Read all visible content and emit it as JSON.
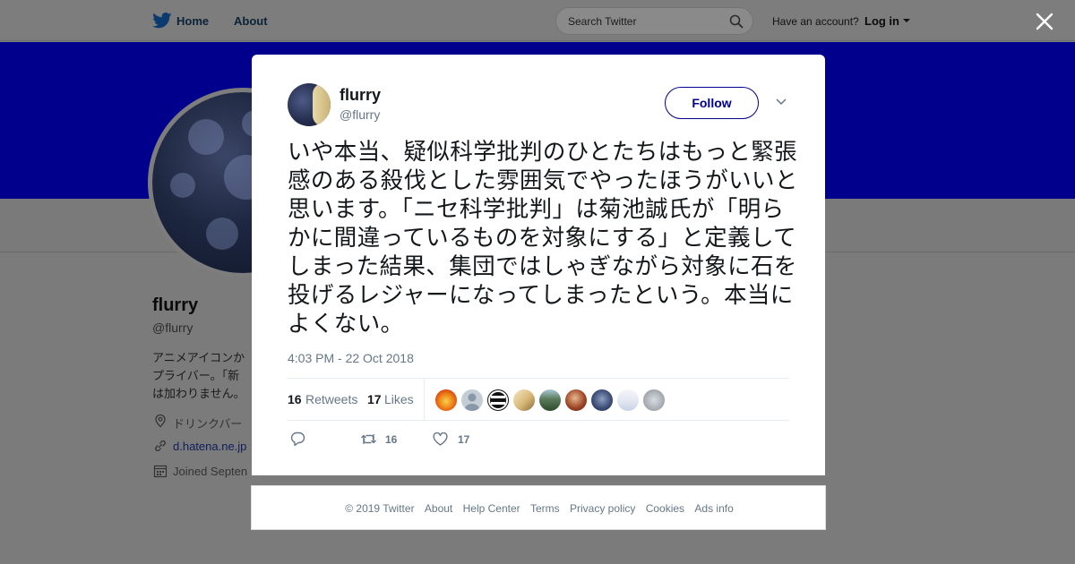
{
  "nav": {
    "home_label": "Home",
    "about_label": "About",
    "search_placeholder": "Search Twitter",
    "have_account": "Have an account?",
    "login_label": "Log in"
  },
  "colors": {
    "brand": "#00008c",
    "banner": "#00008c",
    "overlay": "#7b7b7b",
    "muted_text": "#657786"
  },
  "profile": {
    "name": "flurry",
    "handle": "@flurry",
    "bio_line1": "アニメアイコンか",
    "bio_line2": "プライバー。「新",
    "bio_line3": "は加わりません。",
    "location": "ドリンクバー",
    "link": "d.hatena.ne.jp",
    "joined": "Joined Septen"
  },
  "tweet": {
    "name": "flurry",
    "handle": "@flurry",
    "follow_label": "Follow",
    "text": "いや本当、疑似科学批判のひとたちはもっと緊張感のある殺伐とした雰囲気でやったほうがいいと思います。「ニセ科学批判」は菊池誠氏が「明らかに間違っているものを対象にする」と定義してしまった結果、集団ではしゃぎながら対象に石を投げるレジャーになってしまったという。本当によくない。",
    "timestamp": "4:03 PM - 22 Oct 2018",
    "retweets_count": "16",
    "retweets_label": "Retweets",
    "likes_count": "17",
    "likes_label": "Likes",
    "action_retweets": "16",
    "action_likes": "17",
    "liker_avatars": [
      "orange-flame",
      "default-gray",
      "funk-logo",
      "anime-blonde",
      "landscape-green",
      "anime-red",
      "blue-figure",
      "white-text-banner",
      "gray-cat"
    ]
  },
  "icons": {
    "bird": "twitter-bird-icon",
    "search": "search-icon",
    "close": "close-icon",
    "chevron": "chevron-down-icon",
    "reply": "reply-icon",
    "retweet": "retweet-icon",
    "like": "heart-icon",
    "location": "location-pin-icon",
    "link": "link-icon",
    "calendar": "calendar-icon"
  },
  "footer": {
    "links": [
      "© 2019 Twitter",
      "About",
      "Help Center",
      "Terms",
      "Privacy policy",
      "Cookies",
      "Ads info"
    ]
  }
}
